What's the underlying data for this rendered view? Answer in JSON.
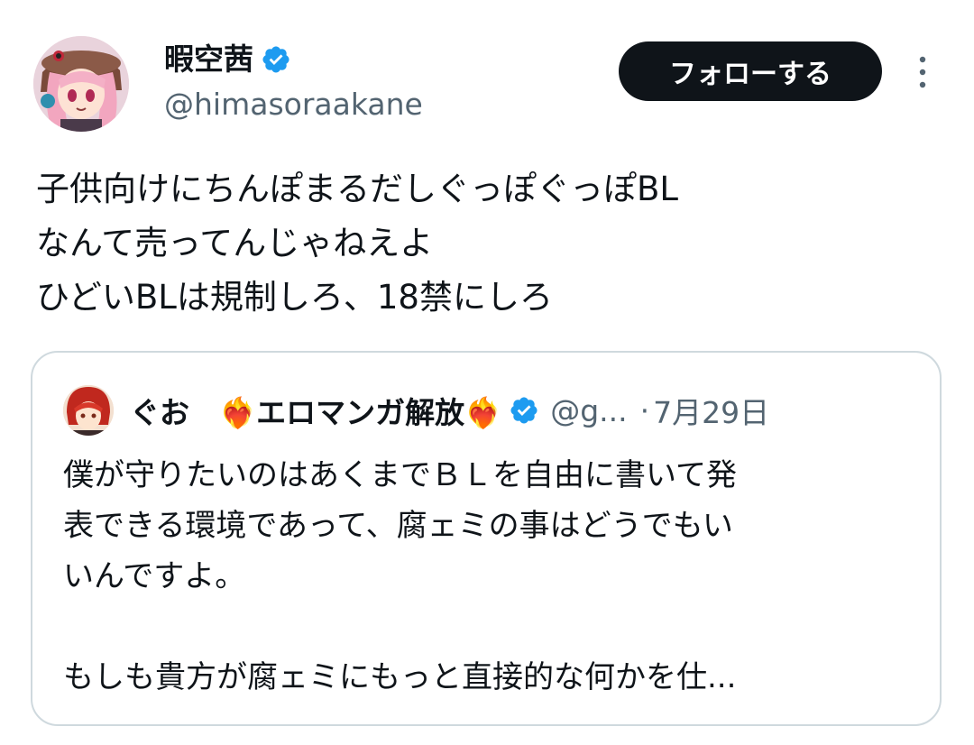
{
  "author": {
    "display_name": "暇空茜",
    "handle": "@himasoraakane",
    "verified": true
  },
  "follow_button": {
    "label": "フォローする"
  },
  "more_icon": "vertical-ellipsis-icon",
  "tweet": {
    "lines": [
      "子供向けにちんぽまるだしぐっぽぐっぽBL",
      "なんて売ってんじゃねえよ",
      "ひどいBLは規制しろ、18禁にしろ"
    ]
  },
  "quoted_tweet": {
    "display_name": "ぐお　❤️‍🔥エロマンガ解放❤️‍🔥",
    "handle": "@g...",
    "separator": "·",
    "date": "7月29日",
    "verified": true,
    "lines": [
      "僕が守りたいのはあくまでＢＬを自由に書いて発",
      "表できる環境であって、腐ェミの事はどうでもい",
      "いんですよ。",
      "",
      "もしも貴方が腐ェミにもっと直接的な何かを仕..."
    ]
  },
  "colors": {
    "text_primary": "#0f1419",
    "text_secondary": "#536471",
    "verified_blue": "#1d9bf0",
    "button_bg": "#0f1419",
    "border": "#cfd9de"
  }
}
